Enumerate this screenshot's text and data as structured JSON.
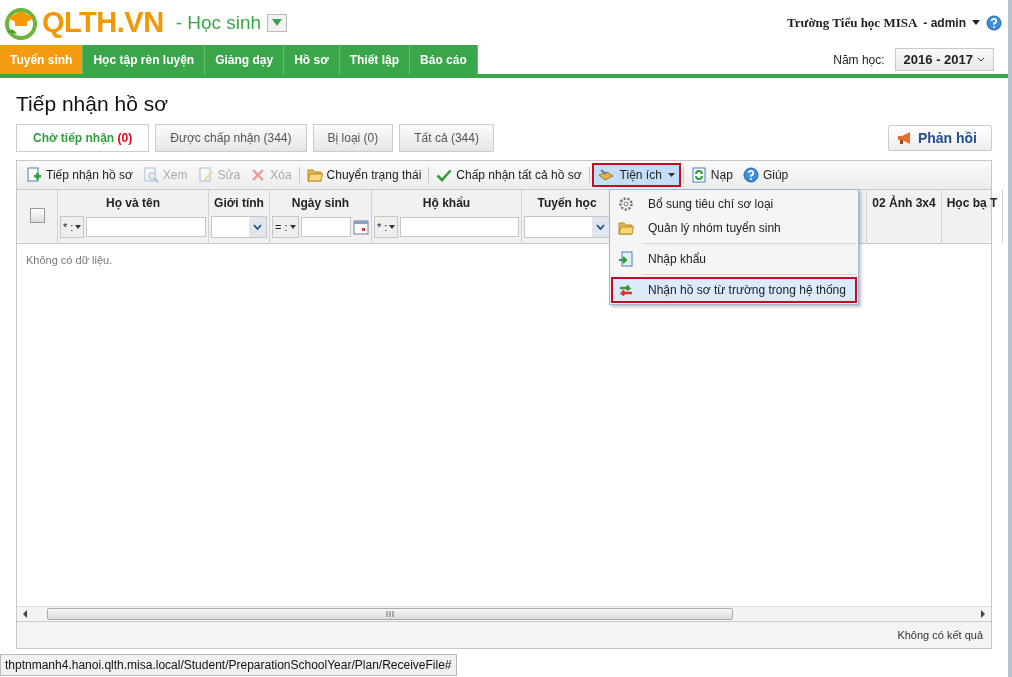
{
  "header": {
    "logo_text": "QLTH.VN",
    "module": "- Học sinh",
    "user": "Trường Tiểu học MISA",
    "account": "- admin",
    "year_label": "Năm học:",
    "year": "2016 - 2017"
  },
  "nav": [
    {
      "label": "Tuyển sinh",
      "selected": true
    },
    {
      "label": "Học tập rèn luyện",
      "selected": false
    },
    {
      "label": "Giảng dạy",
      "selected": false
    },
    {
      "label": "Hồ sơ",
      "selected": false
    },
    {
      "label": "Thiết lập",
      "selected": false
    },
    {
      "label": "Báo cáo",
      "selected": false
    }
  ],
  "page_title": "Tiếp nhận hồ sơ",
  "status_tabs": [
    {
      "label": "Chờ tiếp nhận",
      "count": "(0)",
      "selected": true
    },
    {
      "label": "Được chấp nhận",
      "count": "(344)",
      "selected": false
    },
    {
      "label": "Bị loại",
      "count": "(0)",
      "selected": false
    },
    {
      "label": "Tất cả",
      "count": "(344)",
      "selected": false
    }
  ],
  "feedback_button": "Phản hồi",
  "toolbar": {
    "groups": [
      [
        {
          "label": "Tiếp nhận hồ sơ",
          "kind": "add",
          "disabled": false
        },
        {
          "label": "Xem",
          "kind": "view",
          "disabled": true
        },
        {
          "label": "Sửa",
          "kind": "edit",
          "disabled": true
        },
        {
          "label": "Xóa",
          "kind": "delete",
          "disabled": true
        }
      ],
      [
        {
          "label": "Chuyển trạng thái",
          "kind": "folder",
          "disabled": false
        }
      ],
      [
        {
          "label": "Chấp nhận tất cả hồ sơ",
          "kind": "check",
          "disabled": false
        }
      ]
    ],
    "menu_button": {
      "label": "Tiện ích",
      "expanded": true
    },
    "right_items": [
      {
        "label": "Nạp",
        "kind": "reload",
        "disabled": false
      },
      {
        "label": "Giúp",
        "kind": "help",
        "disabled": false
      }
    ]
  },
  "select_all_checked": false,
  "columns": [
    {
      "label": "Họ và tên",
      "kind": "text-op",
      "operator": "* :"
    },
    {
      "label": "Giới tính",
      "kind": "select"
    },
    {
      "label": "Ngày sinh",
      "kind": "date-op",
      "operator": "= :"
    },
    {
      "label": "Hộ khẩu",
      "kind": "text-op",
      "operator": "* :"
    },
    {
      "label": "Tuyến học",
      "kind": "select"
    },
    {
      "label": "02 Ảnh 3x4",
      "kind": "none"
    },
    {
      "label": "Học bạ T",
      "kind": "none"
    }
  ],
  "empty_text": "Không có dữ liệu.",
  "menu": {
    "groups": [
      [
        {
          "label": "Bổ sung tiêu chí sơ loại",
          "kind": "gear",
          "selected": false
        },
        {
          "label": "Quản lý nhóm tuyển sinh",
          "kind": "folder",
          "selected": false
        }
      ],
      [
        {
          "label": "Nhập khẩu",
          "kind": "import",
          "selected": false
        }
      ],
      [
        {
          "label": "Nhận hồ sơ từ trường trong hệ thống",
          "kind": "transfer",
          "selected": true
        }
      ]
    ]
  },
  "pager": {
    "result_text": "Không có kết quả"
  },
  "status_url": "thptnmanh4.hanoi.qlth.misa.local/Student/PreparationSchoolYear/Plan/ReceiveFile#"
}
